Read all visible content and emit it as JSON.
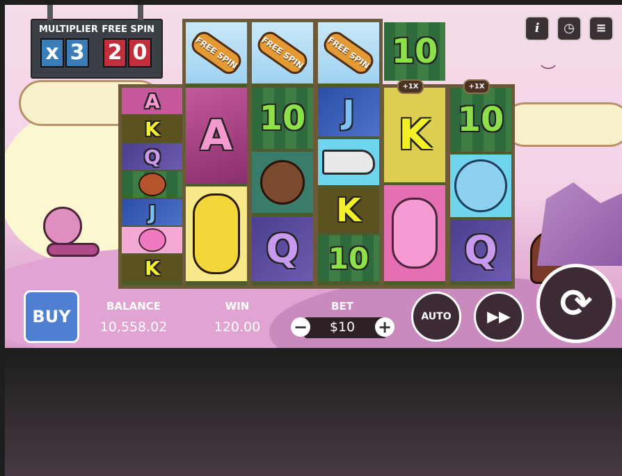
{
  "scoreboard": {
    "multiplier_label": "MULTIPLIER",
    "free_spin_label": "FREE SPIN",
    "multiplier_prefix": "x",
    "multiplier_value": "3",
    "free_spin_digit_1": "2",
    "free_spin_digit_2": "0"
  },
  "top_icons": {
    "info": "i",
    "history": "history-icon",
    "menu": "menu-icon"
  },
  "reels": [
    {
      "symbols": [
        "A",
        "K",
        "Q",
        "dog-head",
        "J",
        "dolphin",
        "K"
      ]
    },
    {
      "symbols": [
        "FREE SPIN",
        "A",
        "yellow-dog"
      ]
    },
    {
      "symbols": [
        "FREE SPIN",
        "10",
        "coconut",
        "Q"
      ]
    },
    {
      "symbols": [
        "FREE SPIN",
        "J",
        "speedboat",
        "K",
        "10"
      ]
    },
    {
      "symbols": [
        "10",
        "K",
        "pink-dolphin"
      ],
      "multiplier": "+1X"
    },
    {
      "symbols": [
        "10",
        "blue-bird",
        "Q"
      ],
      "multiplier": "+1X"
    }
  ],
  "free_spin_text": "FREE SPIN",
  "buy_label": "BUY",
  "balance": {
    "label": "BALANCE",
    "value": "10,558.02"
  },
  "win": {
    "label": "WIN",
    "value": "120.00"
  },
  "bet": {
    "label": "BET",
    "value": "$10",
    "minus": "−",
    "plus": "+"
  },
  "auto_label": "AUTO",
  "colors": {
    "frame": "#6b5a3a",
    "panel_dark": "#3c2b34",
    "multiplier_digit": "#3a7db8",
    "free_spin_digit": "#c22f3a"
  }
}
